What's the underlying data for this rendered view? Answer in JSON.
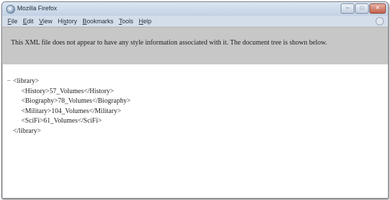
{
  "window": {
    "title": "Mozilla Firefox"
  },
  "window_controls": {
    "minimize": "–",
    "maximize": "□",
    "close": "✕"
  },
  "menu": [
    {
      "label": "File",
      "accel": "F",
      "rest": "ile"
    },
    {
      "label": "Edit",
      "accel": "E",
      "rest": "dit"
    },
    {
      "label": "View",
      "accel": "V",
      "rest": "iew"
    },
    {
      "label": "History",
      "accel": "",
      "pre": "Hi",
      "accel2": "s",
      "rest": "tory"
    },
    {
      "label": "Bookmarks",
      "accel": "B",
      "rest": "ookmarks"
    },
    {
      "label": "Tools",
      "accel": "T",
      "rest": "ools"
    },
    {
      "label": "Help",
      "accel": "H",
      "rest": "elp"
    }
  ],
  "info_bar": {
    "message": "This XML file does not appear to have any style information associated with it. The document tree is shown below."
  },
  "xml": {
    "collapse_toggle": "−",
    "root_open": "<library>",
    "children": [
      "<History>57_Volumes</History>",
      "<Biography>78_Volumes</Biography>",
      "<Military>104_Volumes</Military>",
      "<SciFi>61_Volumes</SciFi>"
    ],
    "root_close": "</library>"
  }
}
